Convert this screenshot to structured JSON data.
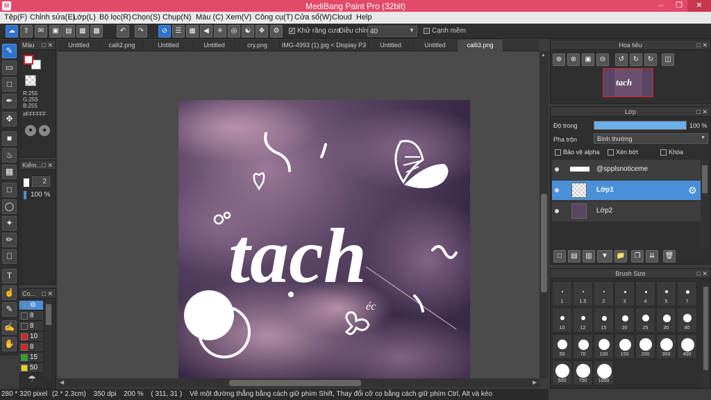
{
  "window": {
    "title": "MediBang Paint Pro (32bit)"
  },
  "menu": [
    "Tệp(F)",
    "Chỉnh sửa(E)",
    "Lớp(L)",
    "Bộ lọc(R)",
    "Chọn(S)",
    "Chụp(N)",
    "Màu (C)",
    "Xem(V)",
    "Công cụ(T)",
    "Cửa sổ(W)",
    "Cloud",
    "Help"
  ],
  "toolbar": {
    "antialias_label": "Khử răng cưa",
    "adjust_label": "Điều chỉnh",
    "adjust_value": "40",
    "edge_label": "Cạnh mềm"
  },
  "tabs": [
    "Untitled",
    "calli2.png",
    "Untitled",
    "Untitled",
    "cry.png",
    "IMG-4993 (1).jpg < Display P3 >",
    "Untitled",
    "Untitled",
    "calli3.png"
  ],
  "active_tab": 8,
  "color_panel": {
    "title": "Màu",
    "r": "R:255",
    "g": "G:255",
    "b": "B:255",
    "hex": "#FFFFFF",
    "fg_color": "#e02020"
  },
  "brush_panel": {
    "title": "Kiểm...",
    "size": "2",
    "opacity": "100 %"
  },
  "color_list": {
    "title": "Co...",
    "items": [
      {
        "label": "",
        "color": "#2a2a2a"
      },
      {
        "label": "8",
        "color": "#2a2a2a"
      },
      {
        "label": "8",
        "color": "#2a2a2a"
      },
      {
        "label": "10",
        "color": "#e02020"
      },
      {
        "label": "8",
        "color": "#e02020"
      },
      {
        "label": "15",
        "color": "#22aa22"
      },
      {
        "label": "50",
        "color": "#e8d21a"
      }
    ]
  },
  "navigator": {
    "title": "Hoa tiêu",
    "thumb_text": "tach"
  },
  "layer_panel": {
    "title": "Lớp",
    "opacity_label": "Độ trong",
    "opacity_value": "100 %",
    "opacity_fraction": 1.0,
    "blend_label": "Pha trộn",
    "blend_value": "Bình thường",
    "protect_alpha": "Bảo vệ alpha",
    "clip": "Xén bớt",
    "lock": "Khóa",
    "layers": [
      {
        "name": "@spplsnoticeme",
        "selected": false
      },
      {
        "name": "Lớp1",
        "selected": true
      },
      {
        "name": "Lớp2",
        "selected": false
      }
    ]
  },
  "brush_size_panel": {
    "title": "Brush Size",
    "sizes": [
      "1",
      "1.5",
      "2",
      "3",
      "4",
      "5",
      "7",
      "10",
      "12",
      "15",
      "20",
      "25",
      "30",
      "40",
      "50",
      "70",
      "100",
      "150",
      "200",
      "300",
      "400",
      "500",
      "700",
      "1000"
    ]
  },
  "canvas": {
    "text": "tach",
    "small_text": "éc"
  },
  "status": {
    "size": "280 * 320 pixel",
    "cm": "(2 * 2.3cm)",
    "dpi": "350 dpi",
    "zoom": "200 %",
    "coords": "( 311, 31 )",
    "hint": "Vẽ một đường thẳng bằng cách giữ phím Shift, Thay đổi cỡ cọ bằng cách giữ phím Ctrl, Alt và kéo"
  }
}
